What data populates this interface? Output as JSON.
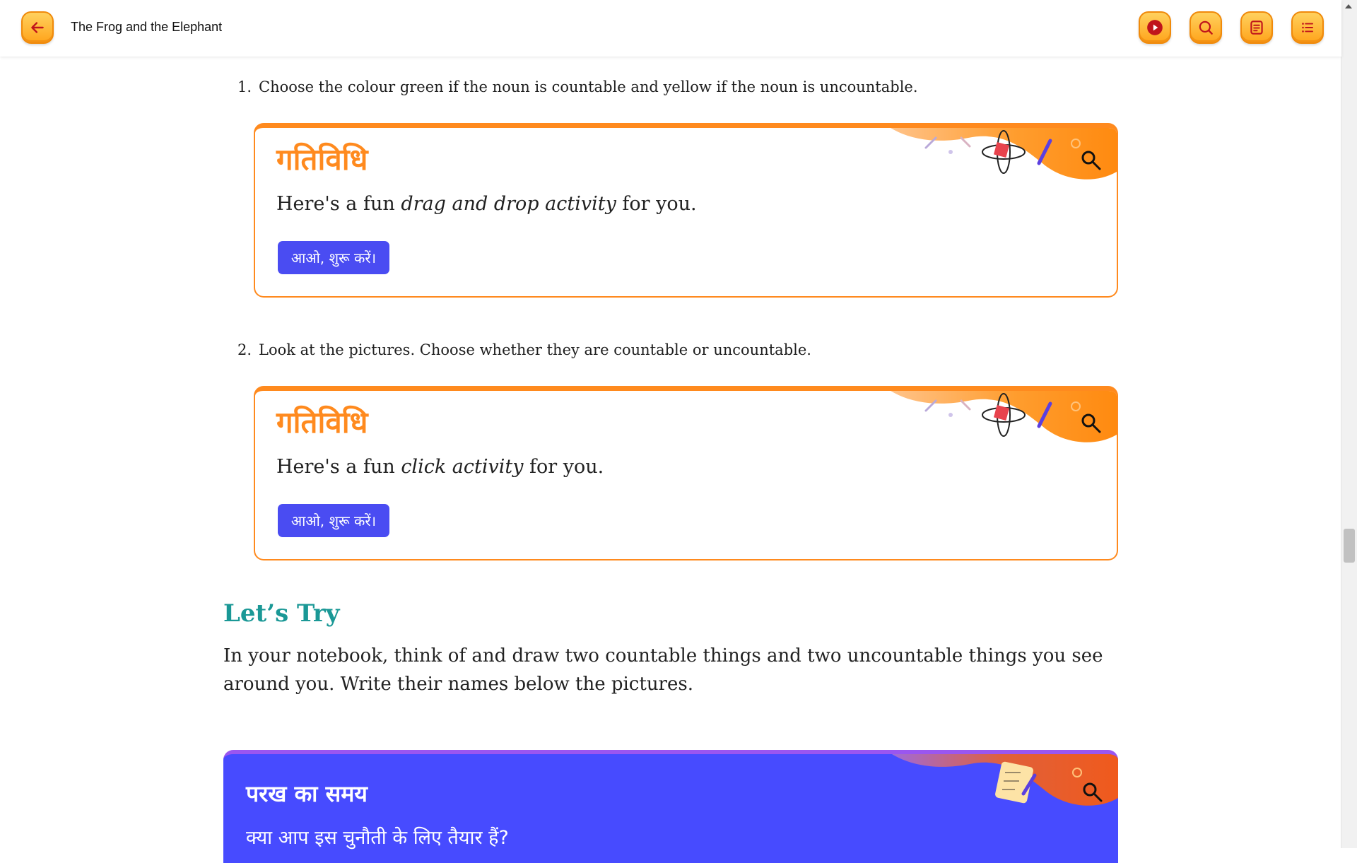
{
  "header": {
    "title": "The Frog and the Elephant",
    "icons": {
      "back": "arrow-left-icon",
      "play": "play-icon",
      "search": "search-icon",
      "notes": "notes-icon",
      "toc": "list-icon"
    }
  },
  "questions": [
    {
      "number": "1.",
      "text": "Choose the colour green if the noun is countable and yellow if the noun is uncountable."
    },
    {
      "number": "2.",
      "text": "Look at the pictures. Choose whether they are countable or uncountable."
    }
  ],
  "activities": [
    {
      "title": "गतिविधि",
      "desc_prefix": "Here's a fun ",
      "desc_emphasis": "drag and drop activity",
      "desc_suffix": " for you.",
      "button": "आओ, शुरू करें।"
    },
    {
      "title": "गतिविधि",
      "desc_prefix": "Here's a fun ",
      "desc_emphasis": "click activity",
      "desc_suffix": " for you.",
      "button": "आओ, शुरू करें।"
    }
  ],
  "lets_try": {
    "heading": "Let’s Try",
    "text": "In your notebook, think of and draw two countable things and two uncountable things you see around you. Write their names below the pictures."
  },
  "test_section": {
    "title": "परख का समय",
    "subtitle": "क्या आप इस चुनौती के लिए तैयार हैं?"
  },
  "colors": {
    "accent_orange": "#ff8a1e",
    "button_blue": "#4a4cf2",
    "heading_teal": "#1a9896",
    "test_bg": "#474bff"
  }
}
